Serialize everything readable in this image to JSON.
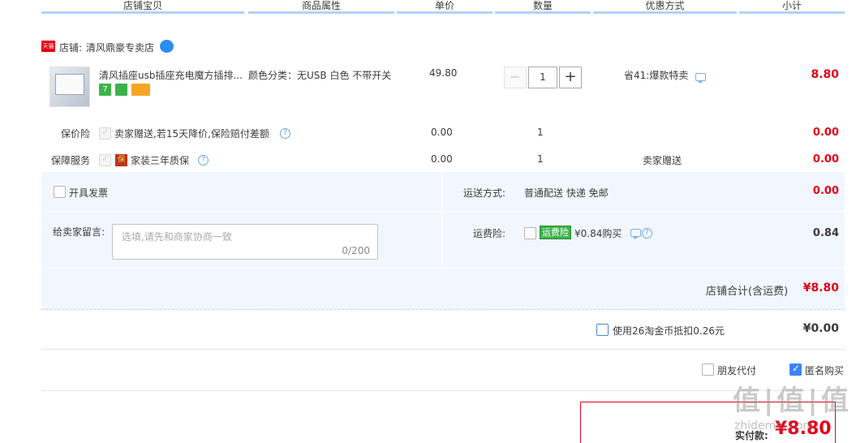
{
  "header": {
    "cols": [
      "店铺宝贝",
      "商品属性",
      "单价",
      "数量",
      "优惠方式",
      "小计"
    ]
  },
  "shop": {
    "badge": "天猫",
    "label": "店铺:",
    "name": "清风鼎豪专卖店"
  },
  "item": {
    "title": "清风插座usb插座充电魔方插排...",
    "attr": "颜色分类：无USB 白色 不带开关",
    "price": "49.80",
    "qty": "1",
    "minus": "−",
    "plus": "+",
    "promo": "省41:爆款特卖",
    "subtotal": "8.80",
    "badges": [
      "7",
      "",
      ""
    ]
  },
  "services": [
    {
      "label": "保价险",
      "desc": "卖家赠送,若15天降价,保险赔付差额",
      "price": "0.00",
      "qty": "1",
      "promo": "",
      "subtotal": "0.00"
    },
    {
      "label": "保障服务",
      "icon": "保",
      "desc": "家装三年质保",
      "price": "0.00",
      "qty": "1",
      "promo": "卖家赠送",
      "subtotal": "0.00"
    }
  ],
  "invoice": {
    "label": "开具发票"
  },
  "shipping": {
    "label": "运送方式:",
    "value": "普通配送 快递 免邮",
    "amount": "0.00"
  },
  "note": {
    "label": "给卖家留言:",
    "placeholder": "选填,请先和商家协商一致",
    "counter": "0/200"
  },
  "insurance": {
    "label": "运费险:",
    "tag": "运费险",
    "desc": "¥0.84购买",
    "amount": "0.84"
  },
  "shop_total": {
    "label": "店铺合计(含运费)",
    "value": "¥8.80"
  },
  "coins": {
    "label": "使用26淘金币抵扣0.26元",
    "value": "¥0.00"
  },
  "options": {
    "friend_pay": "朋友代付",
    "anonymous": "匿名购买"
  },
  "pay": {
    "label": "实付款:",
    "value": "¥8.80"
  },
  "watermark": "值|值|值",
  "watermark_sub": "zhidemai.com",
  "colors": {
    "accent_red": "#e5001a",
    "header_line": "#b2d1ff",
    "panel_bg": "#f2f7ff",
    "tag_green": "#3cb34a"
  }
}
